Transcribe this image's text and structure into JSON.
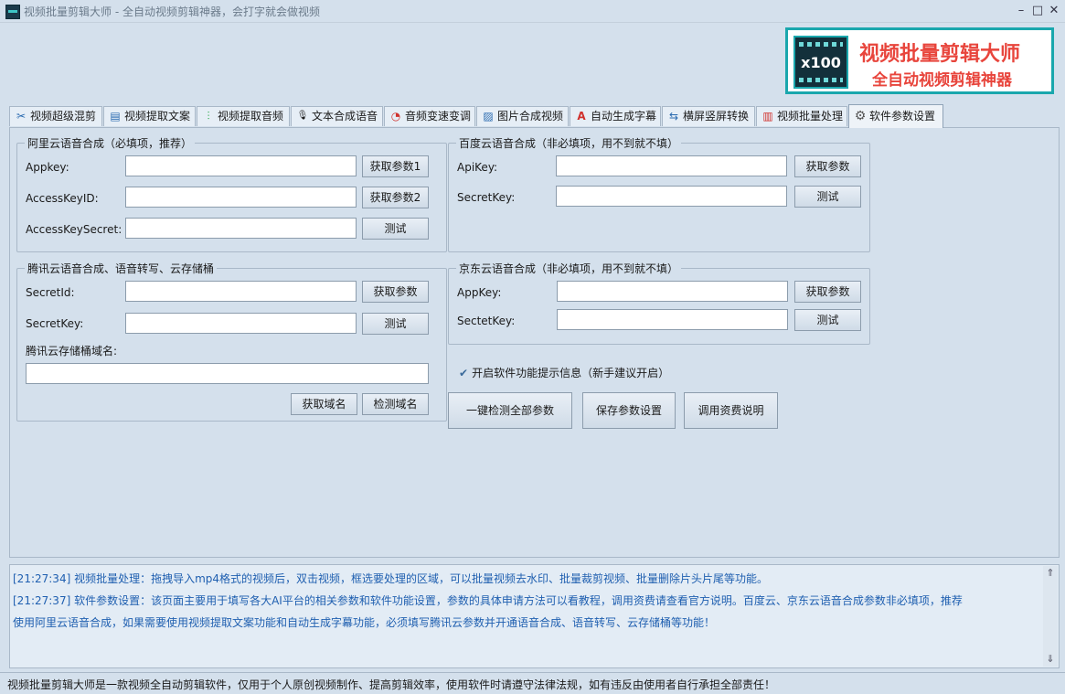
{
  "window": {
    "title": "视频批量剪辑大师 - 全自动视频剪辑神器，会打字就会做视频",
    "min": "–",
    "max": "□",
    "close": "✕"
  },
  "banner": {
    "logo_text": "x100",
    "title": "视频批量剪辑大师",
    "subtitle": "全自动视频剪辑神器"
  },
  "tabs": [
    {
      "label": "视频超级混剪",
      "icon": "✂"
    },
    {
      "label": "视频提取文案",
      "icon": "▤"
    },
    {
      "label": "视频提取音频",
      "icon": "⫶"
    },
    {
      "label": "文本合成语音",
      "icon": "🎙"
    },
    {
      "label": "音频变速变调",
      "icon": "◔"
    },
    {
      "label": "图片合成视频",
      "icon": "▨"
    },
    {
      "label": "自动生成字幕",
      "icon": "A"
    },
    {
      "label": "横屏竖屏转换",
      "icon": "⇆"
    },
    {
      "label": "视频批量处理",
      "icon": "▥"
    },
    {
      "label": "软件参数设置",
      "icon": "⚙"
    }
  ],
  "aliyun": {
    "title": "阿里云语音合成（必填项，推荐）",
    "appkey_label": "Appkey:",
    "appkey_value": "",
    "akid_label": "AccessKeyID:",
    "akid_value": "",
    "aksecret_label": "AccessKeySecret:",
    "aksecret_value": "",
    "btn_get1": "获取参数1",
    "btn_get2": "获取参数2",
    "btn_test": "测试"
  },
  "baidu": {
    "title": "百度云语音合成（非必填项，用不到就不填）",
    "apikey_label": "ApiKey:",
    "apikey_value": "",
    "secret_label": "SecretKey:",
    "secret_value": "",
    "btn_get": "获取参数",
    "btn_test": "测试"
  },
  "tencent": {
    "title": "腾讯云语音合成、语音转写、云存储桶",
    "secretid_label": "SecretId:",
    "secretid_value": "",
    "secretkey_label": "SecretKey:",
    "secretkey_value": "",
    "domain_label": "腾讯云存储桶域名:",
    "domain_value": "",
    "btn_get": "获取参数",
    "btn_test": "测试",
    "btn_get_domain": "获取域名",
    "btn_check_domain": "检测域名"
  },
  "jd": {
    "title": "京东云语音合成（非必填项，用不到就不填）",
    "appkey_label": "AppKey:",
    "appkey_value": "",
    "secret_label": "SectetKey:",
    "secret_value": "",
    "btn_get": "获取参数",
    "btn_test": "测试"
  },
  "options": {
    "tips_check_mark": "✔",
    "tips_label": "开启软件功能提示信息（新手建议开启）",
    "tips_checked": true
  },
  "actions": {
    "check_all": "一键检测全部参数",
    "save": "保存参数设置",
    "billing": "调用资费说明"
  },
  "log": {
    "lines": [
      "[21:27:34] 视频批量处理：拖拽导入mp4格式的视频后，双击视频，框选要处理的区域，可以批量视频去水印、批量裁剪视频、批量删除片头片尾等功能。",
      "[21:27:37] 软件参数设置：该页面主要用于填写各大AI平台的相关参数和软件功能设置，参数的具体申请方法可以看教程，调用资费请查看官方说明。百度云、京东云语音合成参数非必填项，推荐",
      "使用阿里云语音合成，如果需要使用视频提取文案功能和自动生成字幕功能，必须填写腾讯云参数并开通语音合成、语音转写、云存储桶等功能！"
    ],
    "scroll_up": "⇑",
    "scroll_down": "⇓"
  },
  "status": {
    "text": "视频批量剪辑大师是一款视频全自动剪辑软件，仅用于个人原创视频制作、提高剪辑效率，使用软件时请遵守法律法规，如有违反由使用者自行承担全部责任！"
  },
  "colors": {
    "background": "#d4e0ec",
    "accent": "#1aa7ad",
    "brand_red": "#e8453c",
    "log_text": "#1f5fb0"
  }
}
